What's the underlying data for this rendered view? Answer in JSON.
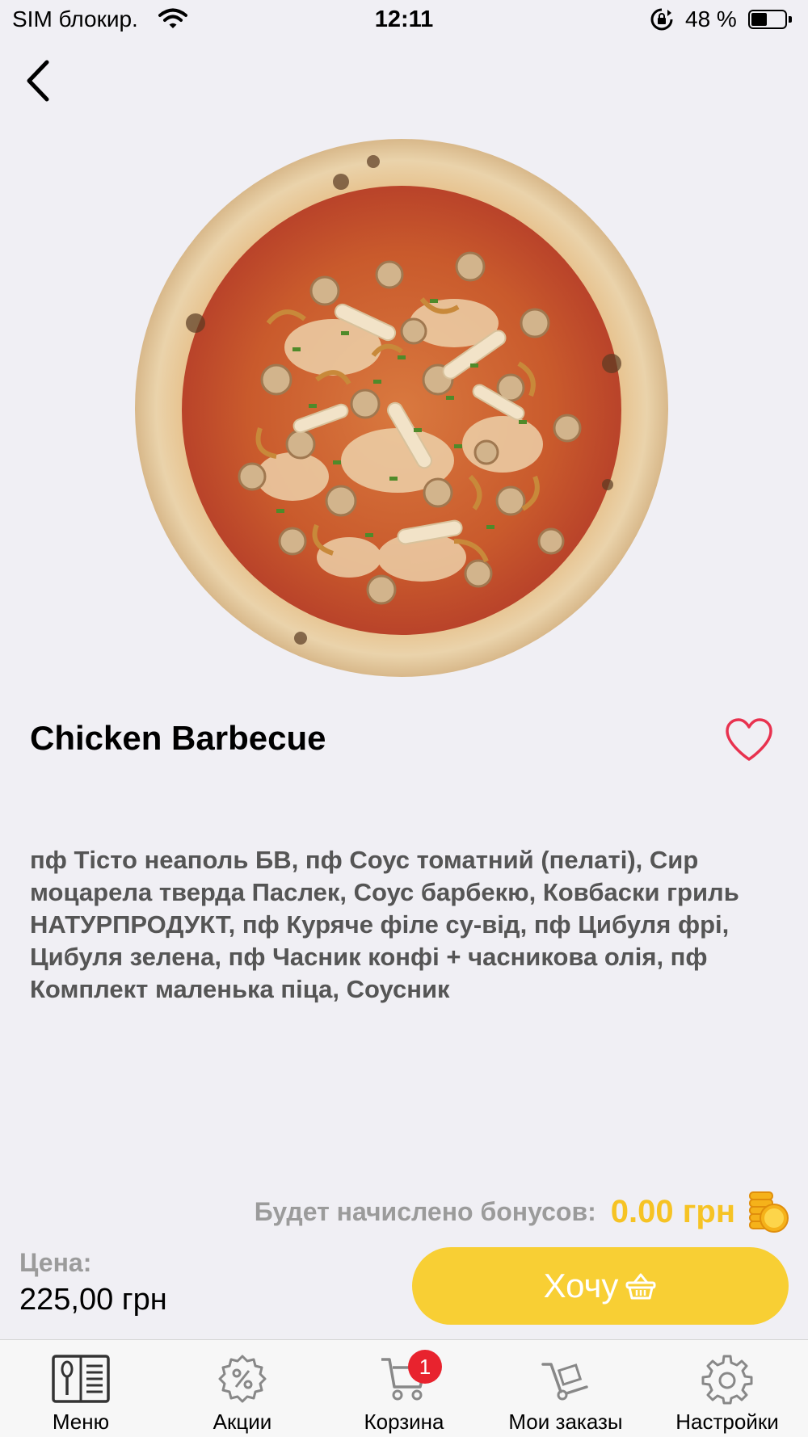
{
  "status_bar": {
    "carrier": "SIM блокир.",
    "time": "12:11",
    "battery_text": "48 %",
    "battery_level": 0.48
  },
  "product": {
    "title": "Chicken Barbecue",
    "description": "пф Тісто неаполь БВ, пф Соус томатний (пелаті), Сир моцарела тверда Паслек, Соус барбекю, Ковбаски гриль НАТУРПРОДУКТ, пф Куряче філе су-від, пф Цибуля фрі, Цибуля зелена, пф Часник конфі + часникова олія, пф Комплект маленька піца, Соусник"
  },
  "bonus": {
    "label": "Будет начислено бонусов:",
    "value": "0.00 грн"
  },
  "price": {
    "label": "Цена:",
    "value": "225,00 грн"
  },
  "want_button": {
    "label": "Хочу"
  },
  "tabs": [
    {
      "label": "Меню",
      "icon": "menu-book-icon"
    },
    {
      "label": "Акции",
      "icon": "discount-gear-icon"
    },
    {
      "label": "Корзина",
      "icon": "cart-icon",
      "badge": "1"
    },
    {
      "label": "Мои заказы",
      "icon": "hand-truck-icon"
    },
    {
      "label": "Настройки",
      "icon": "gear-icon"
    }
  ],
  "colors": {
    "accent": "#f8cf34",
    "bonus": "#f6c324",
    "favorite": "#e8324f",
    "badge": "#e8232e",
    "background": "#f0eff4"
  }
}
